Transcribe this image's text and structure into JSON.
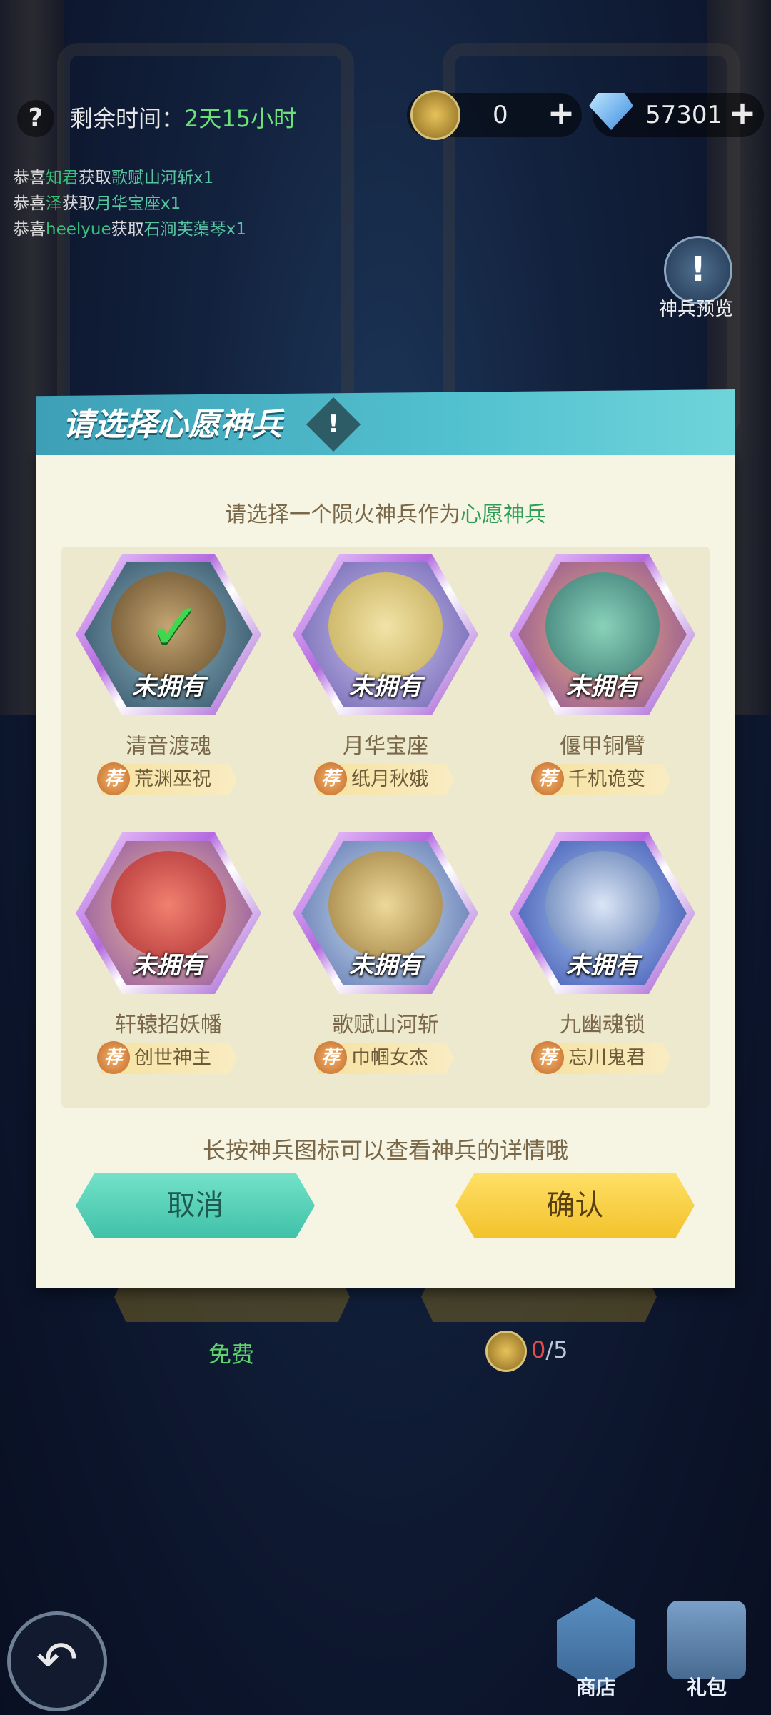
{
  "top_bar": {
    "remaining_label": "剩余时间：",
    "remaining_value": "2天15小时",
    "token_count": "0",
    "diamond_count": "57301",
    "plus": "+"
  },
  "ticker": [
    {
      "prefix": "恭喜",
      "name": "知君",
      "mid": "获取",
      "item": "歌赋山河斩x1"
    },
    {
      "prefix": "恭喜",
      "name": "泽",
      "mid": "获取",
      "item": "月华宝座x1"
    },
    {
      "prefix": "恭喜",
      "name": "heelyue",
      "mid": "获取",
      "item": "石涧芙蕖琴x1"
    }
  ],
  "preview": {
    "icon": "!",
    "label": "神兵预览"
  },
  "modal": {
    "title": "请选择心愿神兵",
    "info_icon": "!",
    "subtitle_prefix": "请选择一个陨火神兵作为",
    "subtitle_highlight": "心愿神兵",
    "items": [
      {
        "name": "清音渡魂",
        "status": "未拥有",
        "tag_badge": "荐",
        "hero": "荒渊巫祝",
        "selected": true,
        "color": "#4a6e7a"
      },
      {
        "name": "月华宝座",
        "status": "未拥有",
        "tag_badge": "荐",
        "hero": "纸月秋娥",
        "selected": false,
        "color": "#c9b04a"
      },
      {
        "name": "偃甲铜臂",
        "status": "未拥有",
        "tag_badge": "荐",
        "hero": "千机诡变",
        "selected": false,
        "color": "#3fa090"
      },
      {
        "name": "轩辕招妖幡",
        "status": "未拥有",
        "tag_badge": "荐",
        "hero": "创世神主",
        "selected": false,
        "color": "#d6453a"
      },
      {
        "name": "歌赋山河斩",
        "status": "未拥有",
        "tag_badge": "荐",
        "hero": "巾帼女杰",
        "selected": false,
        "color": "#c7a04a"
      },
      {
        "name": "九幽魂锁",
        "status": "未拥有",
        "tag_badge": "荐",
        "hero": "忘川鬼君",
        "selected": false,
        "color": "#3a6fd0"
      }
    ],
    "hint": "长按神兵图标可以查看神兵的详情哦",
    "cancel": "取消",
    "confirm": "确认"
  },
  "bottom": {
    "free": "免费",
    "cost_used": "0",
    "cost_total": "/5",
    "shop": "商店",
    "gift": "礼包",
    "back_icon": "↶"
  },
  "colors": {
    "accent_green": "#6de07a",
    "header_teal": "#52c1cf",
    "confirm_yellow": "#f2c22b",
    "cancel_teal": "#3fc1a8"
  }
}
